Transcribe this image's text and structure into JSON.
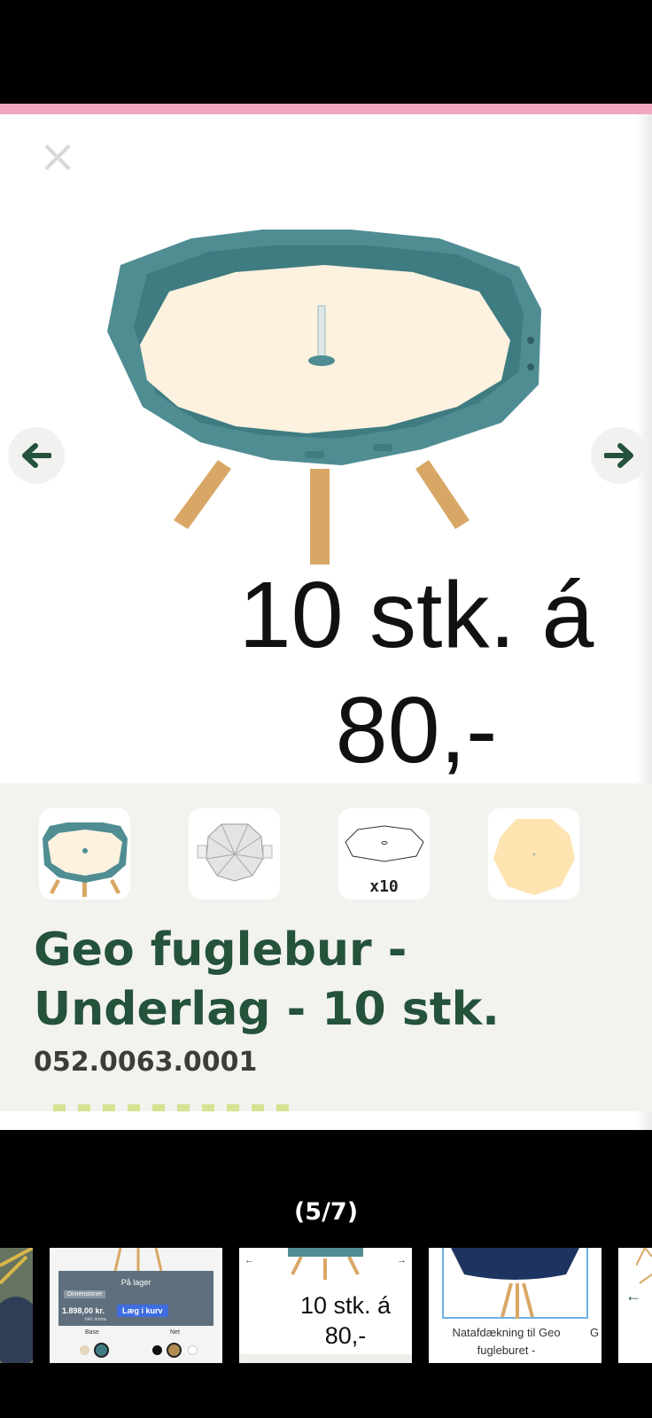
{
  "viewer": {
    "promo_text": "10 stk. á 80,-",
    "counter": "(5/7)"
  },
  "product": {
    "title": "Geo fuglebur - Underlag - 10 stk.",
    "sku": "052.0063.0001"
  },
  "thumbnails": [
    {
      "name": "table-base"
    },
    {
      "name": "wire-dome"
    },
    {
      "name": "underlay-outline",
      "caption": "x10"
    },
    {
      "name": "cream-underlay"
    }
  ],
  "strip": {
    "item2": {
      "stock": "På lager",
      "tab": "Dimensioner",
      "price": "1.898,00 kr.",
      "price_note": "Inkl. moms",
      "cart_button": "Læg i kurv",
      "label_base": "Base",
      "label_net": "Net"
    },
    "item3": {
      "text_line1": "10 stk. á",
      "text_line2": "80,-"
    },
    "item4": {
      "line1": "Natafdækning til Geo",
      "line2": "fugleburet -",
      "next_peek": "G"
    }
  },
  "colors": {
    "brand_green": "#24523b",
    "pink_accent": "#f2a7c1",
    "teal_product": "#4f8d93",
    "cart_blue": "#3f6de0"
  },
  "icons": [
    "close-icon",
    "arrow-left-icon",
    "arrow-right-icon"
  ]
}
